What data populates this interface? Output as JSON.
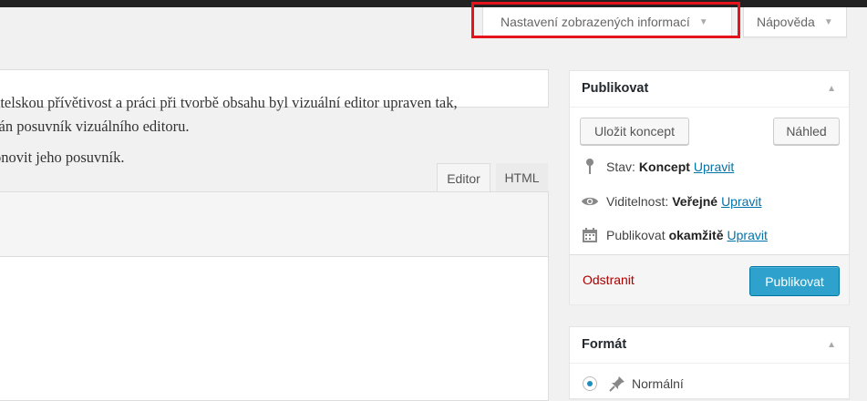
{
  "screen_meta": {
    "screen_options_label": "Nastavení zobrazených informací",
    "help_label": "Nápověda"
  },
  "editor": {
    "tab_visual": "Editor",
    "tab_html": "HTML",
    "paragraphs": [
      "atelskou přívětivost a práci při tvorbě obsahu byl vizuální editor upraven tak,",
      "rán posuvník vizuálního editoru.",
      "onovit jeho posuvník."
    ]
  },
  "publish_box": {
    "title": "Publikovat",
    "save_draft": "Uložit koncept",
    "preview": "Náhled",
    "status_label": "Stav:",
    "status_value": "Koncept",
    "visibility_label": "Viditelnost:",
    "visibility_value": "Veřejné",
    "schedule_label": "Publikovat",
    "schedule_value": "okamžitě",
    "edit_link": "Upravit",
    "delete_label": "Odstranit",
    "publish_label": "Publikovat"
  },
  "format_box": {
    "title": "Formát",
    "selected_option": "Normální"
  },
  "colors": {
    "accent": "#2ea2cc",
    "link": "#0073aa",
    "delete": "#aa0000",
    "highlight": "#e5141b"
  },
  "icons": [
    "caret-down-icon",
    "pin-icon",
    "eye-icon",
    "calendar-icon",
    "pushpin-icon",
    "collapse-arrow-icon"
  ]
}
